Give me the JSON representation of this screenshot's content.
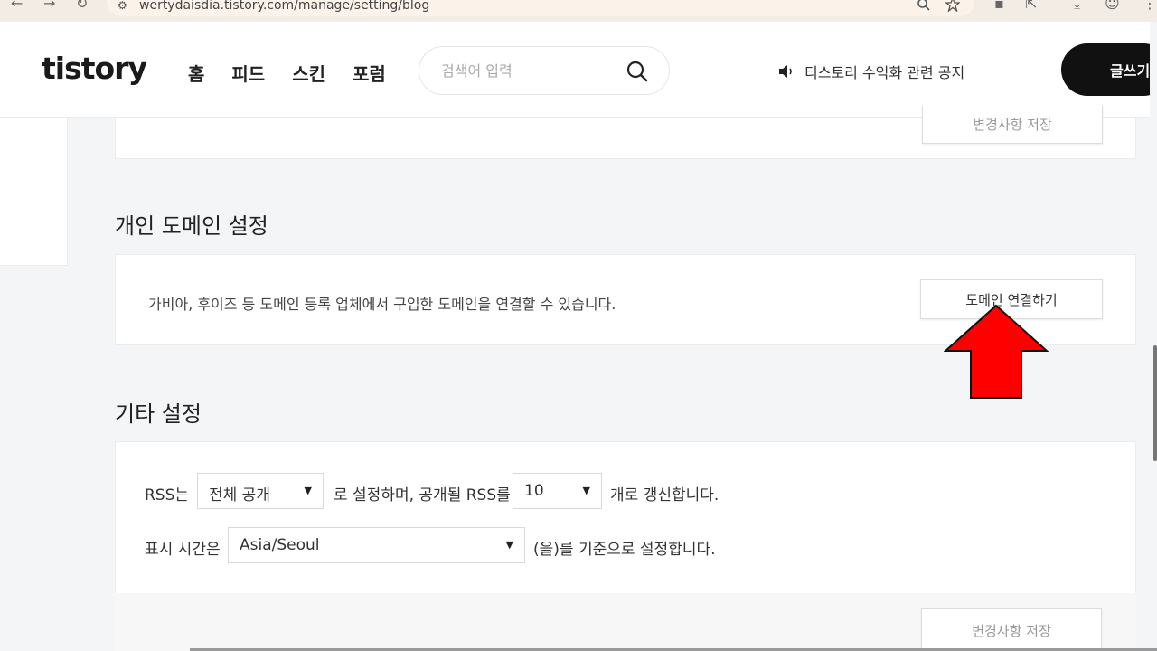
{
  "browser": {
    "url": "wertydaisdia.tistory.com/manage/setting/blog",
    "nav_glyphs": [
      "←",
      "→",
      "↻"
    ]
  },
  "header": {
    "logo": "tistory",
    "nav": [
      "홈",
      "피드",
      "스킨",
      "포럼"
    ],
    "search_placeholder": "검색어 입력",
    "notice": "티스토리 수익화 관련 공지",
    "write_label": "글쓰기"
  },
  "top_card": {
    "save_label": "변경사항 저장"
  },
  "domain_section": {
    "title": "개인 도메인 설정",
    "description": "가비아, 후이즈 등 도메인 등록 업체에서 구입한 도메인을 연결할 수 있습니다.",
    "connect_label": "도메인 연결하기"
  },
  "etc_section": {
    "title": "기타 설정",
    "rss_prefix": "RSS는",
    "rss_visibility": "전체 공개",
    "rss_middle": "로 설정하며, 공개될 RSS를",
    "rss_count": "10",
    "rss_suffix": "개로 갱신합니다.",
    "time_prefix": "표시 시간은",
    "timezone": "Asia/Seoul",
    "time_suffix": "(을)를 기준으로 설정합니다.",
    "save_label": "변경사항 저장"
  },
  "colors": {
    "arrow": "#ff0000",
    "write_button_bg": "#111111"
  }
}
